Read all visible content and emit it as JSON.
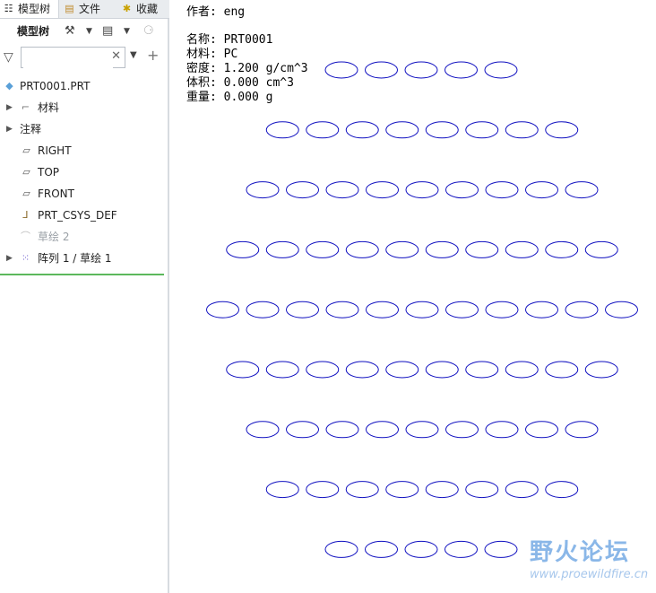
{
  "tabs": [
    {
      "label": "模型树",
      "icon": "model-tree-icon"
    },
    {
      "label": "文件",
      "icon": "folder-icon"
    },
    {
      "label": "收藏",
      "icon": "favorites-icon"
    }
  ],
  "toolbar": {
    "title": "模型树"
  },
  "search": {
    "value": "",
    "placeholder": ""
  },
  "tree": [
    {
      "label": "PRT0001.PRT",
      "icon": "part-icon"
    },
    {
      "label": "材料",
      "icon": "material-icon"
    },
    {
      "label": "注释",
      "icon": ""
    },
    {
      "label": "RIGHT",
      "icon": "datum-plane-icon"
    },
    {
      "label": "TOP",
      "icon": "datum-plane-icon"
    },
    {
      "label": "FRONT",
      "icon": "datum-plane-icon"
    },
    {
      "label": "PRT_CSYS_DEF",
      "icon": "csys-icon"
    },
    {
      "label": "草绘 2",
      "icon": "sketch-icon"
    },
    {
      "label": "阵列 1 / 草绘 1",
      "icon": "pattern-icon"
    }
  ],
  "drawing": {
    "author_line": "作者: eng",
    "name_line": "名称: PRT0001",
    "material_line": "材料: PC",
    "density_line": "密度: 1.200 g/cm^3",
    "volume_line": "体积: 0.000 cm^3",
    "weight_line": "重量: 0.000 g",
    "ellipse_color": "#1010c0",
    "pattern_rows": [
      5,
      8,
      9,
      10,
      11,
      10,
      9,
      8,
      5
    ]
  },
  "watermark": {
    "text": "野火论坛",
    "url": "www.proewildfire.cn"
  }
}
